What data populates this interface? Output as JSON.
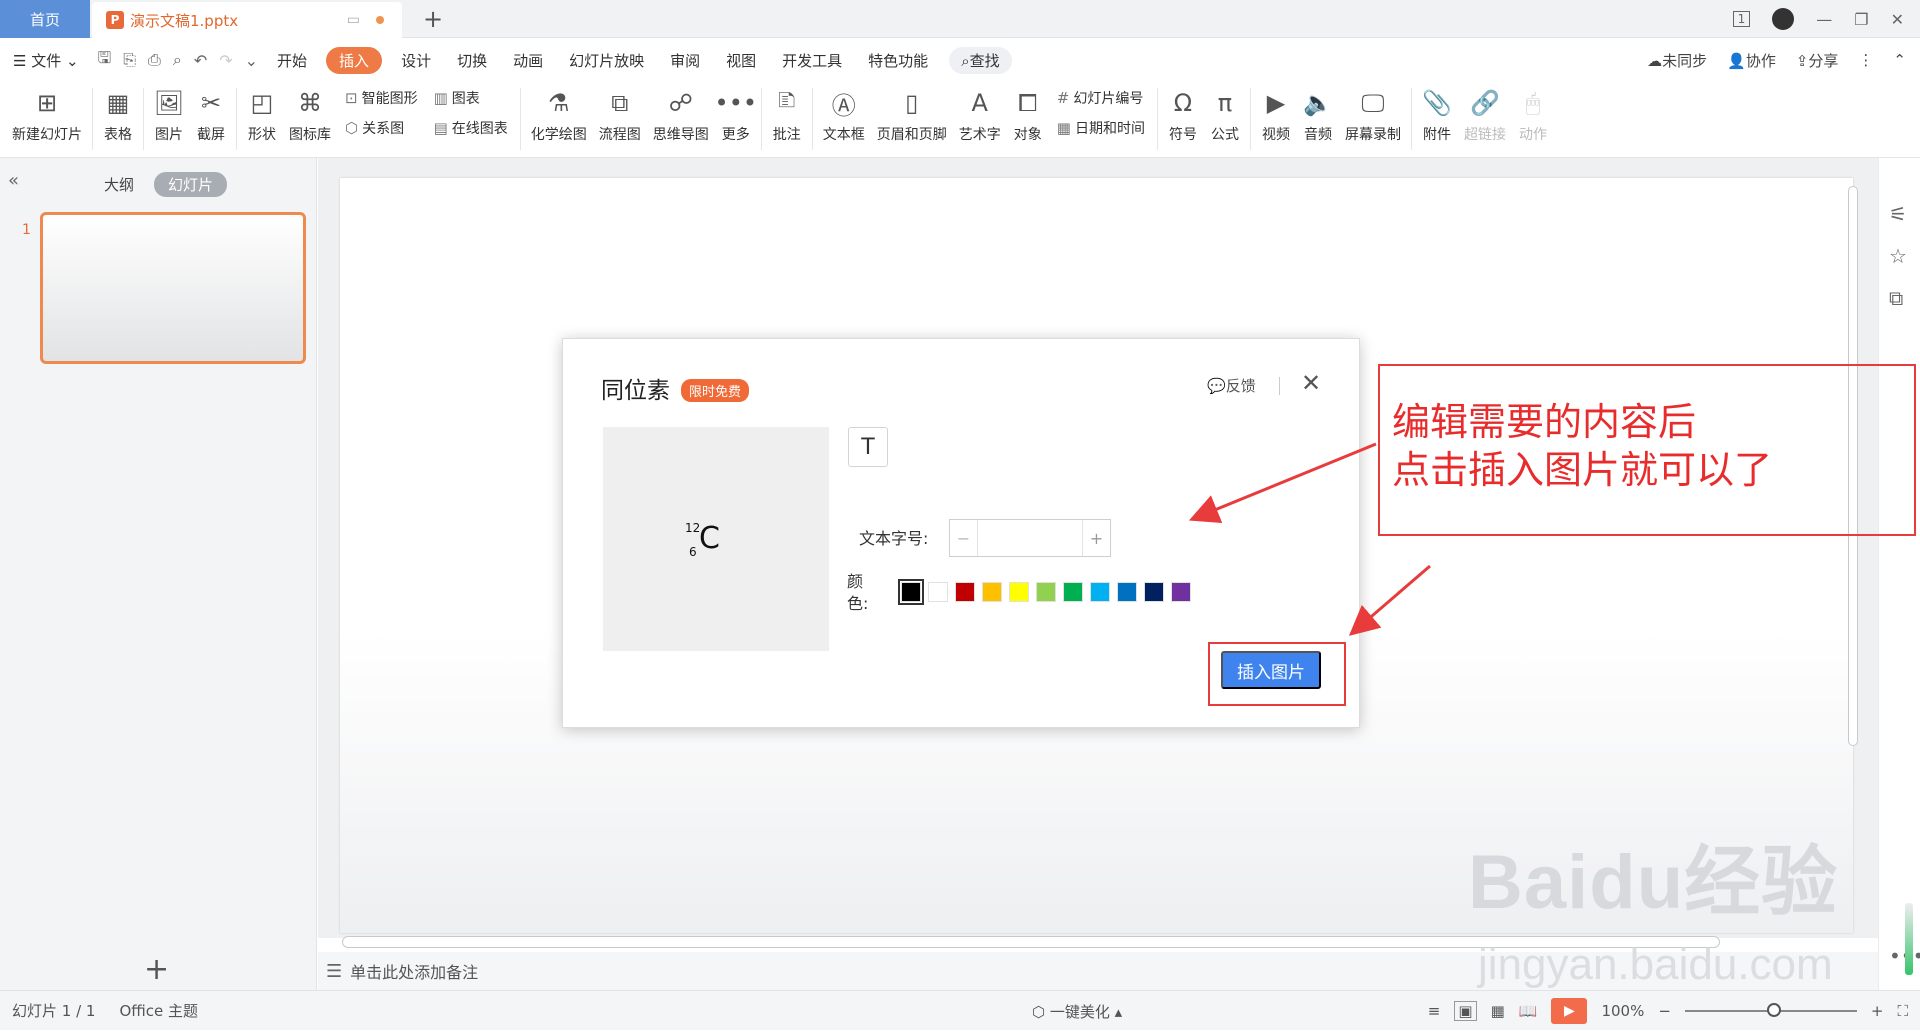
{
  "tabs": {
    "home": "首页",
    "document": "演示文稿1.pptx",
    "new_tab": "+"
  },
  "window": {
    "page_indicator": "1"
  },
  "menu": {
    "file": "文件",
    "items": [
      "开始",
      "插入",
      "设计",
      "切换",
      "动画",
      "幻灯片放映",
      "审阅",
      "视图",
      "开发工具",
      "特色功能"
    ],
    "active": "插入",
    "search": "查找",
    "right": {
      "sync": "未同步",
      "collab": "协作",
      "share": "分享"
    }
  },
  "ribbon": {
    "new_slide": "新建幻灯片",
    "table": "表格",
    "picture": "图片",
    "screenshot": "截屏",
    "shape": "形状",
    "icon_lib": "图标库",
    "smart_art": "智能图形",
    "relation": "关系图",
    "chart": "图表",
    "online_chart": "在线图表",
    "chem": "化学绘图",
    "flow": "流程图",
    "mindmap": "思维导图",
    "more": "更多",
    "comment": "批注",
    "textbox": "文本框",
    "header_footer": "页眉和页脚",
    "wordart": "艺术字",
    "object": "对象",
    "slide_number": "幻灯片编号",
    "datetime": "日期和时间",
    "symbol": "符号",
    "formula": "公式",
    "video": "视频",
    "audio": "音频",
    "screen_record": "屏幕录制",
    "attachment": "附件",
    "hyperlink": "超链接",
    "action": "动作"
  },
  "left_panel": {
    "outline_tab": "大纲",
    "slides_tab": "幻灯片",
    "slide_number": "1"
  },
  "notes_placeholder": "单击此处添加备注",
  "dialog": {
    "title": "同位素",
    "badge": "限时免费",
    "feedback": "反馈",
    "isotope": {
      "mass": "12",
      "atomic": "6",
      "symbol": "C"
    },
    "size_label": "文本字号:",
    "size_value": "",
    "color_label": "颜色:",
    "swatches": [
      "#000000",
      "#ffffff",
      "#c00000",
      "#ffc000",
      "#ffff00",
      "#92d050",
      "#00b050",
      "#00b0f0",
      "#0070c0",
      "#002060",
      "#7030a0"
    ],
    "insert_button": "插入图片"
  },
  "annotation": {
    "line1": "编辑需要的内容后",
    "line2": "点击插入图片就可以了"
  },
  "status": {
    "slide_info": "幻灯片 1 / 1",
    "theme": "Office 主题",
    "beautify": "一键美化",
    "zoom": "100%"
  },
  "watermark": {
    "brand": "Baidu经验",
    "url": "jingyan.baidu.com"
  }
}
